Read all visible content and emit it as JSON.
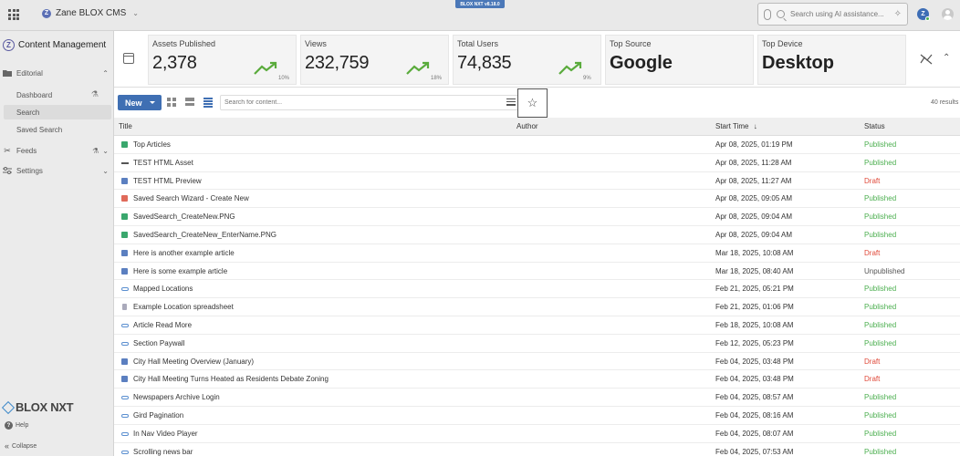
{
  "header": {
    "workspace": "Zane BLOX CMS",
    "version_badge": "BLOX NXT v8.18.0",
    "ai_search_placeholder": "Search using AI assistance..."
  },
  "sidebar": {
    "title": "Content Management",
    "sections": [
      {
        "label": "Editorial",
        "icon": "folder-icon"
      },
      {
        "label": "Feeds",
        "icon": "scissors-icon"
      },
      {
        "label": "Settings",
        "icon": "sliders-icon"
      }
    ],
    "editorial_items": [
      {
        "label": "Dashboard",
        "active": false
      },
      {
        "label": "Search",
        "active": true
      },
      {
        "label": "Saved Search",
        "active": false
      }
    ],
    "brand": "BLOX NXT",
    "help_label": "Help",
    "collapse_label": "Collapse"
  },
  "stats": [
    {
      "label": "Assets Published",
      "value": "2,378",
      "pct": "10%"
    },
    {
      "label": "Views",
      "value": "232,759",
      "pct": "18%"
    },
    {
      "label": "Total Users",
      "value": "74,835",
      "pct": "9%"
    },
    {
      "label": "Top Source",
      "value": "Google"
    },
    {
      "label": "Top Device",
      "value": "Desktop"
    }
  ],
  "toolbar": {
    "new_label": "New",
    "search_placeholder": "Search for content...",
    "favorite_icon": "☆",
    "results": "40 results"
  },
  "table": {
    "columns": {
      "title": "Title",
      "author": "Author",
      "start_time": "Start Time",
      "status": "Status"
    },
    "rows": [
      {
        "icon": "image",
        "title": "Top Articles",
        "date": "Apr 08, 2025, 01:19 PM",
        "status": "Published"
      },
      {
        "icon": "html",
        "title": "TEST HTML Asset",
        "date": "Apr 08, 2025, 11:28 AM",
        "status": "Published"
      },
      {
        "icon": "article",
        "title": "TEST HTML Preview",
        "date": "Apr 08, 2025, 11:27 AM",
        "status": "Draft"
      },
      {
        "icon": "wizard",
        "title": "Saved Search Wizard - Create New",
        "date": "Apr 08, 2025, 09:05 AM",
        "status": "Published"
      },
      {
        "icon": "image",
        "title": "SavedSearch_CreateNew.PNG",
        "date": "Apr 08, 2025, 09:04 AM",
        "status": "Published"
      },
      {
        "icon": "image",
        "title": "SavedSearch_CreateNew_EnterName.PNG",
        "date": "Apr 08, 2025, 09:04 AM",
        "status": "Published"
      },
      {
        "icon": "article",
        "title": "Here is another example article",
        "date": "Mar 18, 2025, 10:08 AM",
        "status": "Draft"
      },
      {
        "icon": "article",
        "title": "Here is some example article",
        "date": "Mar 18, 2025, 08:40 AM",
        "status": "Unpublished"
      },
      {
        "icon": "link",
        "title": "Mapped Locations",
        "date": "Feb 21, 2025, 05:21 PM",
        "status": "Published"
      },
      {
        "icon": "file",
        "title": "Example Location spreadsheet",
        "date": "Feb 21, 2025, 01:06 PM",
        "status": "Published"
      },
      {
        "icon": "link",
        "title": "Article Read More",
        "date": "Feb 18, 2025, 10:08 AM",
        "status": "Published"
      },
      {
        "icon": "link",
        "title": "Section Paywall",
        "date": "Feb 12, 2025, 05:23 PM",
        "status": "Published"
      },
      {
        "icon": "article",
        "title": "City Hall Meeting Overview (January)",
        "date": "Feb 04, 2025, 03:48 PM",
        "status": "Draft"
      },
      {
        "icon": "article",
        "title": "City Hall Meeting Turns Heated as Residents Debate Zoning",
        "date": "Feb 04, 2025, 03:48 PM",
        "status": "Draft"
      },
      {
        "icon": "link",
        "title": "Newspapers Archive Login",
        "date": "Feb 04, 2025, 08:57 AM",
        "status": "Published"
      },
      {
        "icon": "link",
        "title": "Gird Pagination",
        "date": "Feb 04, 2025, 08:16 AM",
        "status": "Published"
      },
      {
        "icon": "link",
        "title": "In Nav Video Player",
        "date": "Feb 04, 2025, 08:07 AM",
        "status": "Published"
      },
      {
        "icon": "link",
        "title": "Scrolling news bar",
        "date": "Feb 04, 2025, 07:53 AM",
        "status": "Published"
      }
    ]
  },
  "colors": {
    "accent": "#3f6fb3",
    "published": "#4caf50",
    "draft": "#e04a3a",
    "trend": "#5aab3c"
  }
}
